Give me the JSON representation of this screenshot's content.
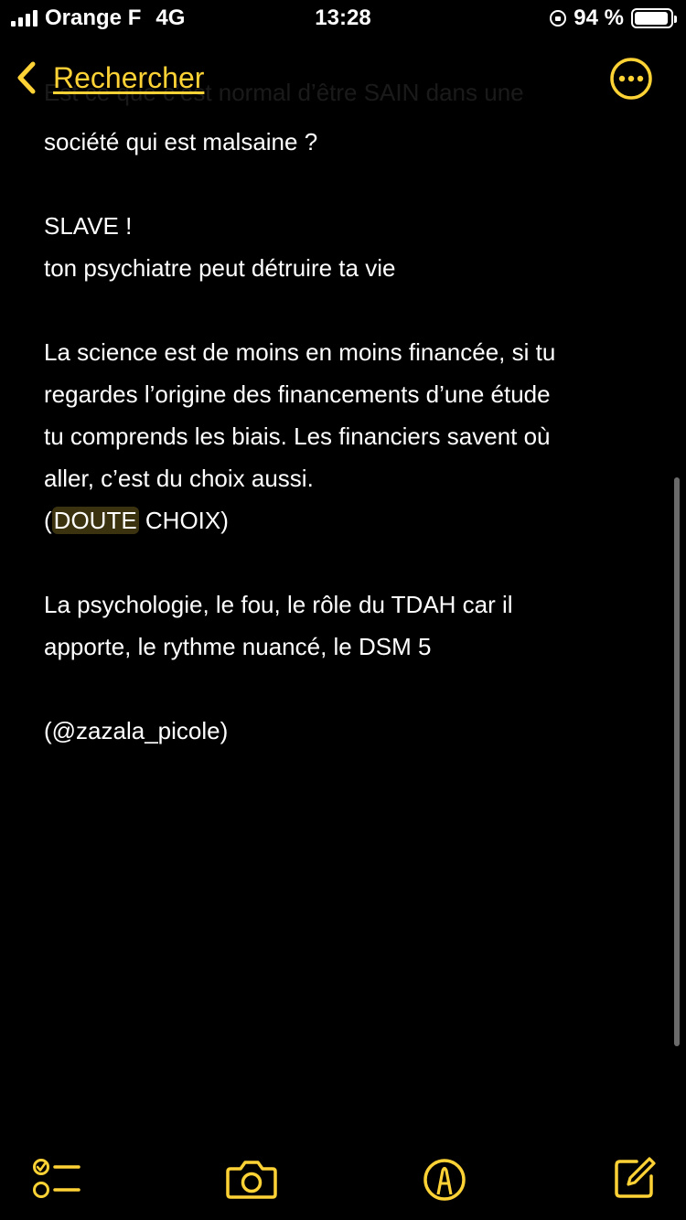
{
  "status_bar": {
    "carrier": "Orange F",
    "network": "4G",
    "time": "13:28",
    "battery_percent": "94 %",
    "battery_level": 0.94
  },
  "nav": {
    "back_label": "Rechercher",
    "ghost_text": "Est ce que c’est normal d’être SAIN dans une"
  },
  "note": {
    "lines": [
      "société qui est malsaine ?",
      "",
      "SLAVE !",
      "ton psychiatre peut détruire ta vie",
      "",
      "La science est de moins en moins financée, si tu",
      "regardes l’origine des financements d’une étude",
      "tu comprends les biais. Les financiers savent où",
      "aller, c’est du choix aussi."
    ],
    "paren_open": "(",
    "highlight_word": "DOUTE",
    "after_highlight": " CHOIX)",
    "lines_after": [
      "",
      "La psychologie, le fou, le rôle du TDAH car il",
      "apporte, le rythme nuancé, le DSM 5",
      "",
      "(@zazala_picole)"
    ]
  },
  "colors": {
    "accent": "#ffd235",
    "background": "#000000",
    "text": "#ffffff",
    "highlight": "#3b3310"
  },
  "toolbar": {
    "icons": [
      "checklist-icon",
      "camera-icon",
      "markup-icon",
      "compose-icon"
    ]
  }
}
